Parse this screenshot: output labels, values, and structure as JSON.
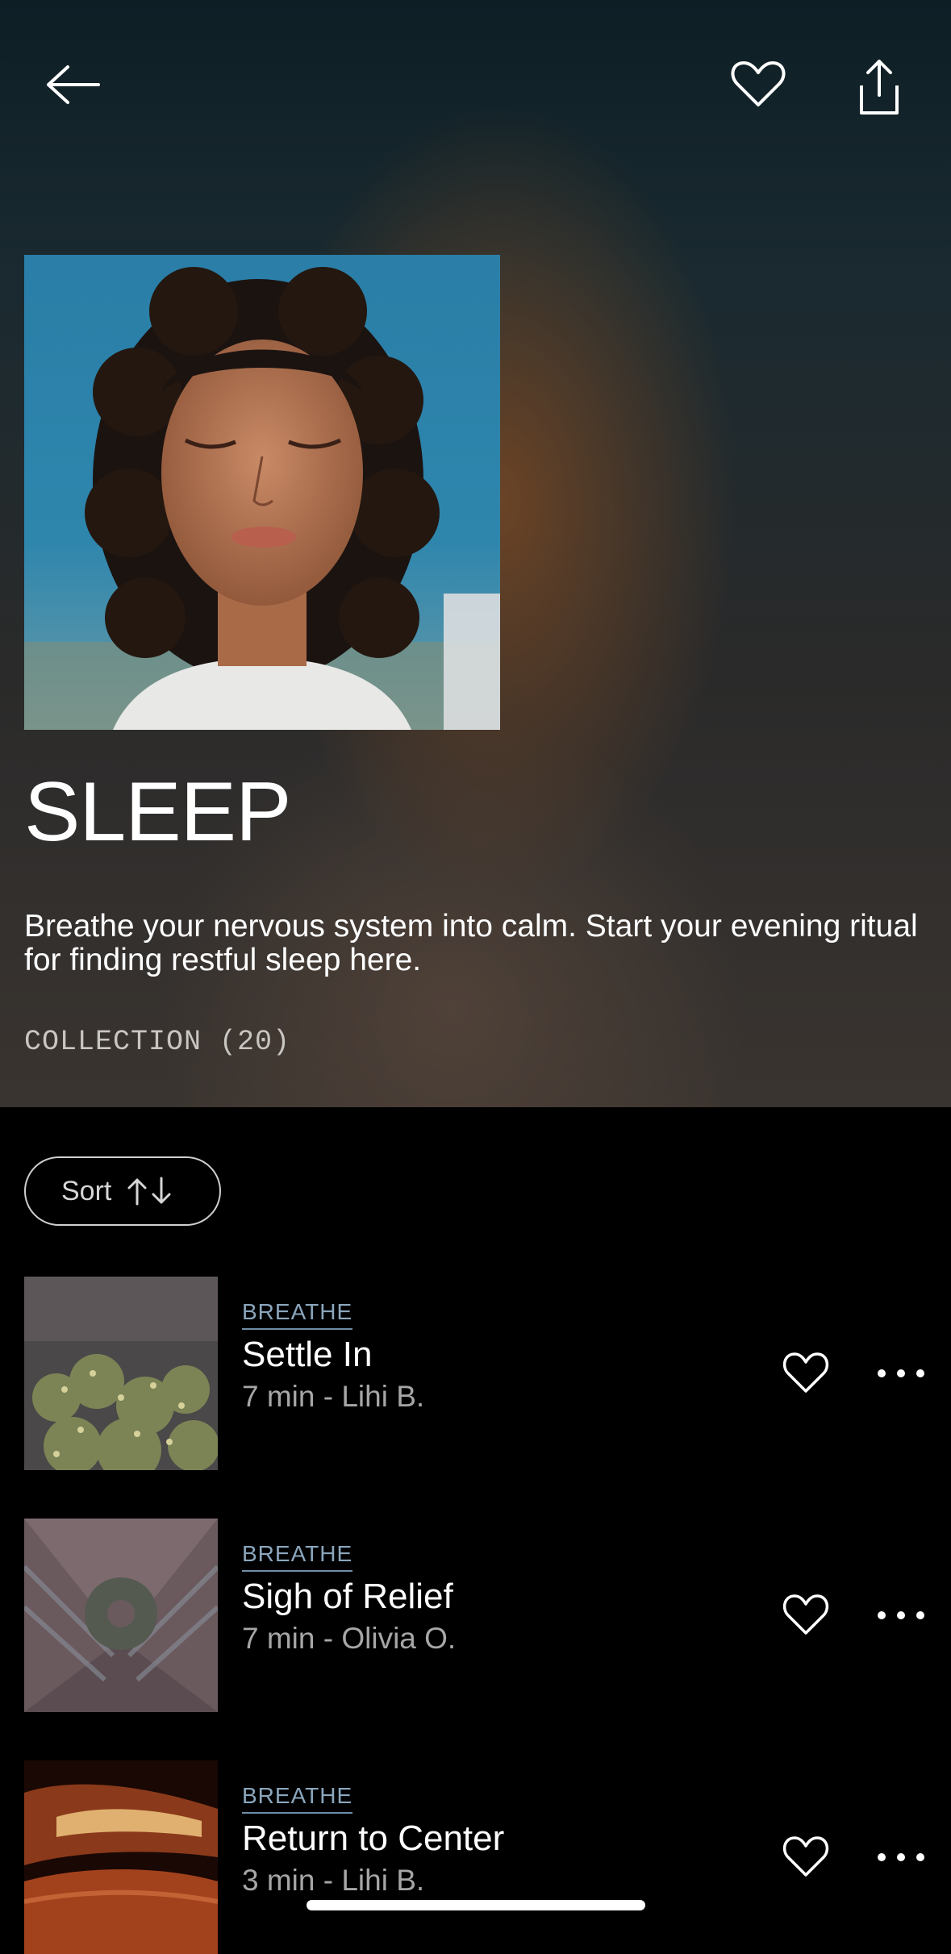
{
  "header": {
    "back_icon": "arrow-left-icon",
    "favorite_icon": "heart-outline-icon",
    "share_icon": "share-icon"
  },
  "hero": {
    "title": "SLEEP",
    "description": "Breathe your nervous system into calm. Start your evening ritual for finding restful sleep here.",
    "collection_label": "COLLECTION (20)"
  },
  "sort": {
    "label": "Sort",
    "icon": "sort-arrows-icon"
  },
  "tracks": [
    {
      "category": "BREATHE",
      "title": "Settle In",
      "meta": "7 min - Lihi B."
    },
    {
      "category": "BREATHE",
      "title": "Sigh of Relief",
      "meta": "7 min - Olivia O."
    },
    {
      "category": "BREATHE",
      "title": "Return to Center",
      "meta": "3 min - Lihi B."
    }
  ],
  "colors": {
    "background": "#000000",
    "category_accent": "#8aa6bd",
    "meta_text": "#a6a6a6"
  }
}
